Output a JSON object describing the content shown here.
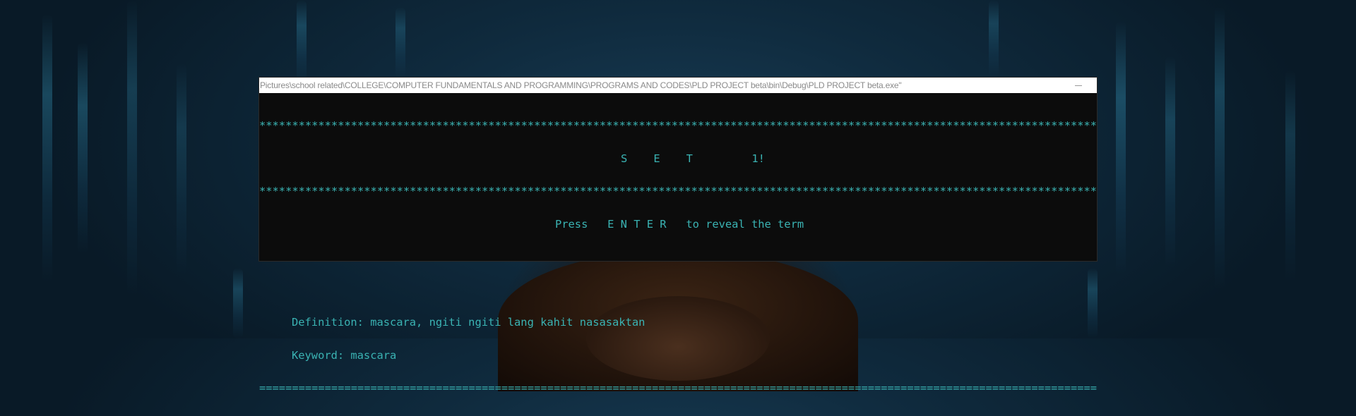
{
  "window": {
    "title": "Pictures\\school related\\COLLEGE\\COMPUTER FUNDAMENTALS AND PROGRAMMING\\PROGRAMS AND CODES\\PLD PROJECT beta\\bin\\Debug\\PLD PROJECT beta.exe\"",
    "minimize_icon": "minimize-icon"
  },
  "console": {
    "border_top": "***********************************************************************************************************************************************",
    "set_heading": "S    E    T         1!",
    "border_mid": "***********************************************************************************************************************************************",
    "prompt": "Press   E N T E R   to reveal the term",
    "definition": "Definition: mascara, ngiti ngiti lang kahit nasasaktan",
    "keyword": "Keyword: mascara",
    "divider": "=================================================================================================================================================",
    "text_color": "#3ab3b3",
    "background": "#0c0c0c"
  },
  "background": {
    "description_colors": [
      "#173a52",
      "#091a27"
    ]
  }
}
